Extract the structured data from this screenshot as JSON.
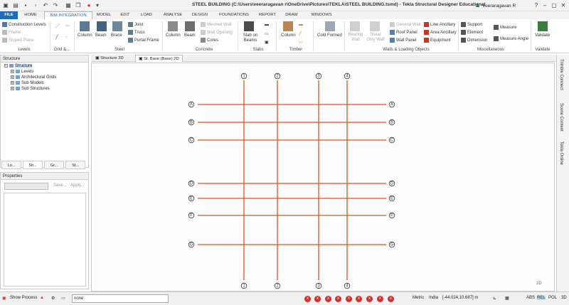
{
  "titlebar": {
    "title": "STEEL BUILDING (C:\\Users\\veeraragavan r\\OneDrive\\Pictures\\TEKLA\\STEEL BUILDING.tsmd) - Tekla Structural Designer Educational",
    "user": "Veeraragavan R"
  },
  "tabs": [
    "FILE",
    "HOME",
    "BIM INTEGRATION",
    "MODEL",
    "EDIT",
    "LOAD",
    "ANALYSE",
    "DESIGN",
    "FOUNDATIONS",
    "REPORT",
    "DRAW",
    "WINDOWS"
  ],
  "active_tab": "BIM INTEGRATION",
  "ribbon": {
    "levels": {
      "label": "Levels",
      "construction_levels": "Construction Levels",
      "frame": "Frame",
      "sloped_plane": "Sloped Plane"
    },
    "grid": {
      "label": "Grid &..."
    },
    "steel": {
      "label": "Steel",
      "column": "Column",
      "beam": "Beam",
      "brace": "Brace",
      "joist": "Joist",
      "truss": "Truss",
      "portal_frame": "Portal Frame"
    },
    "concrete": {
      "label": "Concrete",
      "column": "Column",
      "beam": "Beam",
      "meshed_wall": "Meshed Wall",
      "wall_opening": "Wall Opening",
      "cores": "Cores"
    },
    "slabs": {
      "label": "Slabs",
      "slab_on_beams": "Slab on Beams"
    },
    "timber": {
      "label": "Timber",
      "column": "Column"
    },
    "cold_formed": {
      "label": "Cold Formed"
    },
    "walls": {
      "label": "Walls & Loading Objects",
      "bearing_wall": "Bearing Wall",
      "shear_only_wall": "Shear Only Wall",
      "general_wall": "General Wall",
      "roof_panel": "Roof Panel",
      "wall_panel": "Wall Panel",
      "line_ancillary": "Line Ancillary",
      "area_ancillary": "Area Ancillary",
      "equipment": "Equipment"
    },
    "misc": {
      "label": "Miscellaneous",
      "support": "Support",
      "element": "Element",
      "dimension": "Dimension",
      "measure": "Measure",
      "measure_angle": "Measure Angle"
    },
    "validate": {
      "label": "Validate",
      "button": "Validate"
    }
  },
  "doc_tabs": [
    "Structure 3D",
    "St. Base (Base) 2D"
  ],
  "structure_panel": {
    "title": "Structure",
    "root": "Structure",
    "children": [
      "Levels",
      "Architectural Grids",
      "Sub Models",
      "Sub Structures"
    ]
  },
  "panel_tabs": [
    "Lo...",
    "Str...",
    "Gr...",
    "St..."
  ],
  "properties_panel": {
    "title": "Properties",
    "save": "Save...",
    "apply": "Apply..."
  },
  "grid": {
    "columns": [
      "1",
      "2",
      "3",
      "4"
    ],
    "rows": [
      "A",
      "B",
      "C",
      "D",
      "E",
      "F",
      "G"
    ],
    "line_color": "#e0521f"
  },
  "view_ctrl": "2D",
  "side_tabs": [
    "Trimble Connect",
    "Scene Content",
    "Tekla Online"
  ],
  "statusbar": {
    "show_process": "Show Process",
    "command": "none",
    "errors": [
      "x",
      "x",
      "x",
      "x",
      "x",
      "x",
      "x",
      "x",
      "x"
    ],
    "units": "Metric",
    "region": "India",
    "coords": "[-44.024,10.687] m",
    "modes": [
      "ABS",
      "REL",
      "POL",
      "3D"
    ]
  }
}
